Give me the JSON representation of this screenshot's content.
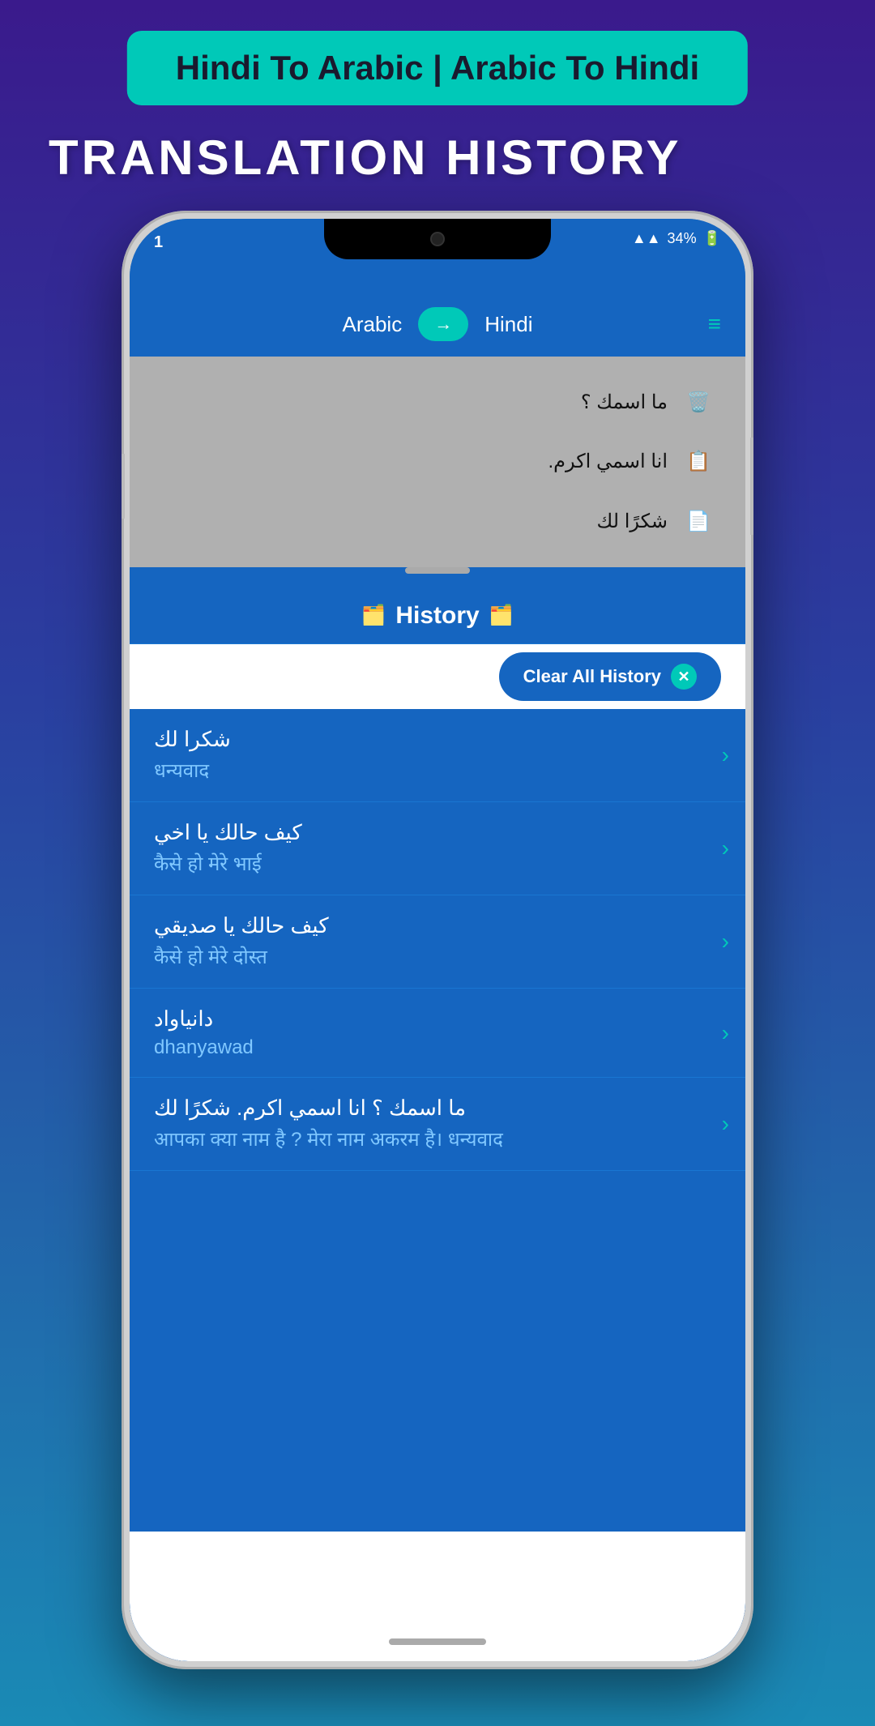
{
  "app": {
    "banner_text": "Hindi To Arabic | Arabic To Hindi",
    "page_title": "TRANSLATION HISTORY"
  },
  "header": {
    "source_lang": "Arabic",
    "arrow": "→",
    "target_lang": "Hindi",
    "menu_icon": "≡"
  },
  "status_bar": {
    "time": "1",
    "battery": "34%",
    "signal": "▲▲"
  },
  "translation_preview": {
    "items": [
      {
        "text": "ما اسمك ؟",
        "icon": "🗑️"
      },
      {
        "text": "انا اسمي اكرم.",
        "icon": "📋"
      },
      {
        "text": "شكرًا لك",
        "icon": "📄"
      }
    ]
  },
  "history": {
    "title": "History",
    "clear_button": "Clear All History",
    "items": [
      {
        "arabic": "شكرا لك",
        "hindi": "धन्यवाद"
      },
      {
        "arabic": "كيف حالك يا اخي",
        "hindi": "कैसे हो मेरे भाई"
      },
      {
        "arabic": "كيف حالك يا صديقي",
        "hindi": "कैसे हो मेरे दोस्त"
      },
      {
        "arabic": "دانياواد",
        "hindi": "dhanyawad"
      },
      {
        "arabic": "ما اسمك ؟ انا اسمي اكرم. شكرًا لك",
        "hindi": "आपका क्या नाम है ? मेरा नाम अकरम है। धन्यवाद"
      }
    ]
  }
}
